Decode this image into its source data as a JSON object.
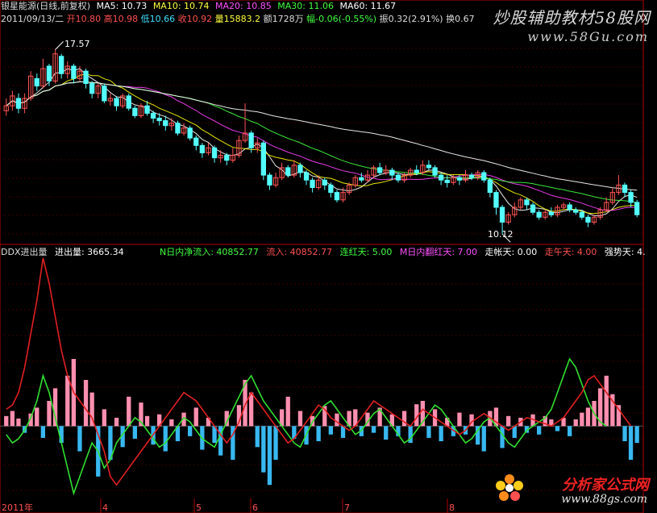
{
  "header": {
    "title": "银星能源(日线,前复权)",
    "ma5": "MA5: 10.73",
    "ma10": "MA10: 10.74",
    "ma20": "MA20: 10.85",
    "ma30": "MA30: 11.06",
    "ma60": "MA60: 11.67",
    "date": "2011/09/13/二",
    "open": "开10.80",
    "high": "高10.98",
    "low": "低10.66",
    "close": "收10.92",
    "vol": "量15883.2",
    "amt": "额1728万",
    "change": "幅-0.06(-0.55%)",
    "amp": "振0.32(2.91%)",
    "turnover": "换0.67"
  },
  "indicator": {
    "name": "DDX进出量",
    "jcl": "进出量: 3665.34",
    "nnet": "N日内净流入: 40852.77",
    "inflow": "流入: 40852.77",
    "lianhong": "连红天: 5.00",
    "mred": "M日内翻红天: 7.00",
    "weak": "走帐天: 0.00",
    "zouwu": "走午天: 4.00",
    "strong": "强势天: 4."
  },
  "price_labels": {
    "high": "17.57",
    "low": "10.12"
  },
  "xaxis": [
    "2011年",
    "4",
    "5",
    "6",
    "7",
    "8"
  ],
  "watermarks": {
    "top_cn": "炒股辅助教材58股网",
    "top_url": "www.58Gu.com",
    "bottom_cn": "分析家公式网",
    "bottom_url": "www.88gs.com"
  },
  "colors": {
    "up": "#ff5454",
    "down": "#54ffff",
    "ma5": "#ffffff",
    "ma10": "#ffff00",
    "ma20": "#ff40ff",
    "ma30": "#40ff40",
    "ma60": "#ffffff",
    "pink": "#ff8fb0",
    "blue": "#38b8f0",
    "red_line": "#e02020",
    "green_line": "#30e030"
  },
  "chart_data": [
    {
      "type": "candlestick",
      "title": "银星能源(日线,前复权)",
      "ylim": [
        9.8,
        18.4
      ],
      "annotations": {
        "max": 17.57,
        "min": 10.12
      },
      "candles": [
        [
          15.1,
          15.3,
          15.6,
          14.9
        ],
        [
          15.3,
          15.7,
          15.9,
          15.1
        ],
        [
          15.6,
          15.2,
          15.8,
          15.0
        ],
        [
          15.2,
          15.6,
          15.8,
          15.0
        ],
        [
          15.6,
          16.5,
          16.7,
          15.5
        ],
        [
          16.4,
          16.1,
          16.6,
          15.9
        ],
        [
          16.1,
          16.8,
          17.2,
          16.0
        ],
        [
          16.9,
          16.3,
          17.0,
          16.1
        ],
        [
          16.3,
          17.4,
          17.57,
          16.2
        ],
        [
          17.3,
          16.6,
          17.4,
          16.4
        ],
        [
          16.6,
          16.9,
          17.1,
          16.4
        ],
        [
          16.9,
          16.4,
          17.0,
          16.2
        ],
        [
          16.4,
          16.7,
          16.9,
          16.3
        ],
        [
          16.7,
          16.2,
          16.8,
          16.0
        ],
        [
          16.2,
          15.8,
          16.3,
          15.6
        ],
        [
          15.8,
          16.1,
          16.2,
          15.6
        ],
        [
          16.1,
          15.5,
          16.2,
          15.4
        ],
        [
          15.5,
          15.6,
          15.8,
          15.3
        ],
        [
          15.6,
          15.3,
          15.7,
          15.1
        ],
        [
          15.3,
          15.7,
          15.8,
          15.2
        ],
        [
          15.7,
          15.2,
          15.8,
          15.1
        ],
        [
          15.2,
          14.9,
          15.3,
          14.8
        ],
        [
          14.9,
          15.3,
          15.4,
          14.8
        ],
        [
          15.3,
          15.0,
          15.5,
          14.9
        ],
        [
          15.0,
          14.8,
          15.1,
          14.6
        ],
        [
          14.8,
          14.7,
          15.0,
          14.5
        ],
        [
          14.7,
          14.5,
          14.9,
          14.3
        ],
        [
          14.5,
          14.6,
          14.8,
          14.3
        ],
        [
          14.6,
          14.2,
          14.7,
          14.1
        ],
        [
          14.2,
          14.4,
          14.6,
          14.1
        ],
        [
          14.4,
          14.0,
          14.5,
          13.9
        ],
        [
          14.0,
          13.7,
          14.1,
          13.5
        ],
        [
          13.7,
          13.4,
          13.8,
          13.2
        ],
        [
          13.4,
          13.6,
          13.8,
          13.3
        ],
        [
          13.6,
          13.2,
          13.7,
          13.0
        ],
        [
          13.2,
          13.3,
          13.5,
          13.0
        ],
        [
          13.3,
          13.1,
          13.4,
          12.9
        ],
        [
          13.1,
          13.3,
          13.6,
          13.0
        ],
        [
          13.3,
          13.9,
          14.1,
          13.2
        ],
        [
          13.9,
          14.2,
          15.4,
          13.8
        ],
        [
          14.2,
          13.6,
          14.3,
          13.4
        ],
        [
          13.6,
          13.8,
          14.0,
          13.4
        ],
        [
          13.8,
          12.5,
          13.9,
          12.3
        ],
        [
          12.5,
          12.1,
          12.6,
          11.9
        ],
        [
          12.1,
          12.4,
          12.6,
          12.0
        ],
        [
          12.4,
          12.8,
          13.0,
          12.3
        ],
        [
          12.8,
          12.5,
          12.9,
          12.4
        ],
        [
          12.5,
          12.9,
          13.1,
          12.4
        ],
        [
          12.9,
          12.6,
          13.0,
          12.4
        ],
        [
          12.6,
          12.3,
          12.7,
          12.1
        ],
        [
          12.3,
          12.0,
          12.4,
          11.8
        ],
        [
          12.0,
          12.3,
          12.5,
          11.9
        ],
        [
          12.3,
          12.1,
          12.4,
          11.9
        ],
        [
          12.1,
          11.8,
          12.2,
          11.6
        ],
        [
          11.8,
          11.5,
          11.9,
          11.4
        ],
        [
          11.5,
          11.8,
          12.0,
          11.4
        ],
        [
          11.8,
          12.1,
          12.2,
          11.7
        ],
        [
          12.1,
          12.4,
          12.5,
          12.0
        ],
        [
          12.4,
          12.3,
          12.6,
          12.2
        ],
        [
          12.3,
          12.5,
          12.7,
          12.2
        ],
        [
          12.5,
          12.8,
          12.9,
          12.4
        ],
        [
          12.8,
          12.6,
          13.0,
          12.5
        ],
        [
          12.6,
          12.7,
          12.9,
          12.5
        ],
        [
          12.7,
          12.5,
          12.8,
          12.3
        ],
        [
          12.5,
          12.3,
          12.6,
          12.2
        ],
        [
          12.3,
          12.5,
          12.6,
          12.2
        ],
        [
          12.5,
          12.7,
          12.8,
          12.4
        ],
        [
          12.7,
          12.6,
          12.9,
          12.5
        ],
        [
          12.6,
          12.9,
          13.1,
          12.5
        ],
        [
          12.9,
          12.8,
          13.1,
          12.7
        ],
        [
          12.8,
          12.5,
          12.9,
          12.4
        ],
        [
          12.5,
          12.3,
          12.6,
          12.1
        ],
        [
          12.3,
          12.2,
          12.5,
          12.0
        ],
        [
          12.2,
          12.4,
          12.5,
          12.1
        ],
        [
          12.4,
          12.3,
          12.5,
          12.1
        ],
        [
          12.3,
          12.5,
          12.7,
          12.2
        ],
        [
          12.5,
          12.4,
          12.6,
          12.3
        ],
        [
          12.4,
          12.6,
          12.7,
          12.3
        ],
        [
          12.6,
          12.3,
          12.7,
          12.2
        ],
        [
          12.3,
          11.8,
          12.4,
          11.6
        ],
        [
          11.8,
          11.2,
          11.9,
          10.9
        ],
        [
          11.2,
          10.6,
          11.3,
          10.12
        ],
        [
          10.6,
          10.9,
          11.0,
          10.5
        ],
        [
          10.9,
          11.2,
          11.4,
          10.8
        ],
        [
          11.2,
          11.5,
          11.6,
          11.1
        ],
        [
          11.5,
          11.3,
          11.6,
          11.1
        ],
        [
          11.3,
          11.0,
          11.4,
          10.9
        ],
        [
          11.0,
          10.8,
          11.1,
          10.7
        ],
        [
          10.8,
          11.0,
          11.1,
          10.7
        ],
        [
          11.0,
          10.9,
          11.2,
          10.8
        ],
        [
          10.9,
          11.2,
          11.3,
          10.8
        ],
        [
          11.2,
          11.3,
          11.4,
          11.1
        ],
        [
          11.3,
          11.1,
          11.4,
          11.0
        ],
        [
          11.1,
          11.0,
          11.2,
          10.9
        ],
        [
          11.0,
          10.8,
          11.1,
          10.7
        ],
        [
          10.8,
          10.6,
          10.9,
          10.4
        ],
        [
          10.6,
          10.8,
          10.9,
          10.5
        ],
        [
          10.8,
          11.1,
          11.2,
          10.7
        ],
        [
          11.1,
          11.4,
          11.6,
          11.0
        ],
        [
          11.4,
          11.8,
          12.0,
          11.3
        ],
        [
          11.8,
          12.1,
          12.5,
          11.7
        ],
        [
          12.1,
          11.8,
          12.2,
          11.6
        ],
        [
          11.8,
          11.4,
          11.9,
          11.2
        ],
        [
          11.4,
          10.9,
          11.5,
          10.8
        ]
      ]
    },
    {
      "type": "bar",
      "title": "DDX进出量",
      "ylim": [
        -90,
        200
      ],
      "bars": [
        12,
        18,
        9,
        -8,
        15,
        22,
        -14,
        30,
        45,
        -20,
        60,
        80,
        -30,
        55,
        40,
        -60,
        20,
        -40,
        10,
        -25,
        35,
        -15,
        28,
        12,
        -22,
        14,
        -30,
        8,
        -18,
        16,
        -12,
        22,
        -28,
        10,
        -20,
        -35,
        18,
        -40,
        25,
        55,
        40,
        -25,
        -55,
        -70,
        -40,
        20,
        35,
        -15,
        18,
        -22,
        12,
        -18,
        24,
        -10,
        15,
        -14,
        18,
        20,
        -12,
        16,
        -8,
        22,
        -16,
        14,
        -12,
        18,
        -20,
        26,
        30,
        -14,
        20,
        -18,
        10,
        -12,
        16,
        -10,
        14,
        -22,
        -30,
        18,
        22,
        -26,
        12,
        -14,
        10,
        -8,
        14,
        -10,
        12,
        8,
        -6,
        10,
        -12,
        8,
        16,
        22,
        30,
        45,
        60,
        38,
        25,
        -18,
        -40,
        -20
      ],
      "red_line": [
        20,
        25,
        40,
        70,
        110,
        150,
        200,
        170,
        130,
        90,
        60,
        40,
        30,
        20,
        10,
        -10,
        -30,
        -60,
        -70,
        -60,
        -50,
        -40,
        -30,
        -20,
        -10,
        0,
        10,
        20,
        30,
        40,
        35,
        30,
        20,
        10,
        0,
        -10,
        -20,
        -10,
        5,
        25,
        40,
        30,
        20,
        10,
        0,
        -10,
        -20,
        -15,
        -5,
        5,
        15,
        25,
        20,
        10,
        5,
        0,
        -5,
        0,
        10,
        20,
        30,
        25,
        20,
        15,
        10,
        5,
        0,
        10,
        20,
        15,
        10,
        5,
        0,
        -5,
        -10,
        -5,
        5,
        10,
        15,
        10,
        5,
        0,
        -5,
        0,
        5,
        10,
        8,
        5,
        3,
        0,
        5,
        10,
        20,
        30,
        40,
        55,
        60,
        50,
        40,
        30,
        20,
        10,
        0
      ],
      "green_line": [
        -10,
        -20,
        -15,
        -5,
        10,
        30,
        60,
        40,
        10,
        -20,
        -50,
        -80,
        -60,
        -40,
        -20,
        -30,
        -50,
        -40,
        -20,
        -10,
        0,
        10,
        5,
        -5,
        -15,
        -25,
        -20,
        -10,
        0,
        10,
        5,
        -5,
        -15,
        -20,
        -25,
        -10,
        5,
        20,
        35,
        50,
        60,
        45,
        30,
        20,
        10,
        0,
        -10,
        -20,
        -25,
        -10,
        5,
        15,
        25,
        30,
        20,
        10,
        0,
        -10,
        -5,
        5,
        15,
        20,
        10,
        0,
        -10,
        -20,
        -15,
        -5,
        5,
        15,
        25,
        20,
        10,
        0,
        -10,
        -20,
        -15,
        -5,
        5,
        10,
        0,
        -10,
        -20,
        -25,
        -15,
        -5,
        0,
        5,
        10,
        20,
        40,
        60,
        80,
        70,
        50,
        30,
        15,
        5,
        0
      ]
    }
  ]
}
